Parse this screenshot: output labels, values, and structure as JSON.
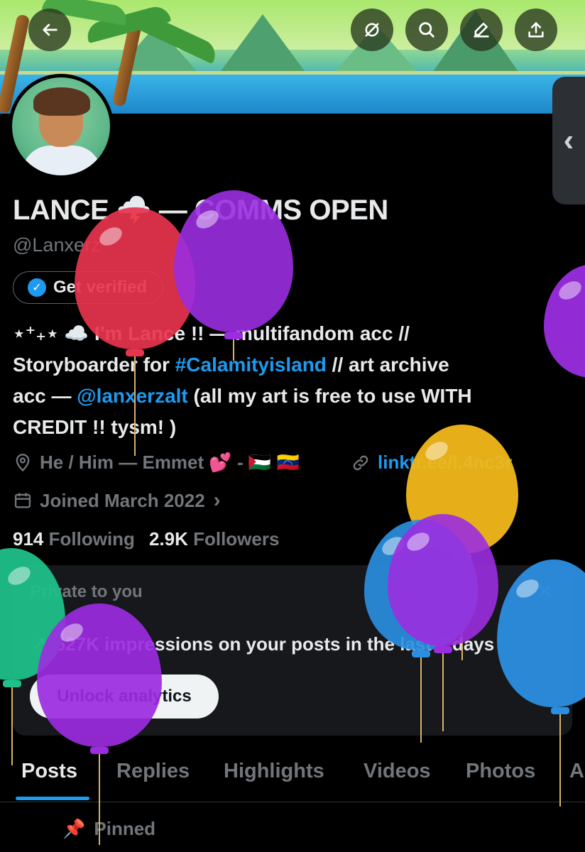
{
  "header": {
    "back_icon": "arrow-left-icon",
    "actions": [
      "grok-icon",
      "search-icon",
      "edit-icon",
      "share-icon"
    ]
  },
  "profile": {
    "display_name": "LANCE 🌩️ — COMMS OPEN",
    "handle": "@Lanxerz",
    "verify_label": "Get verified",
    "bio": {
      "line1": "⋆⁺₊⋆ ☁️ I'm Lance !! — multifandom acc //",
      "line2_prefix": "Storyboarder for ",
      "line2_link": "#Calamityisland",
      "line2_suffix": " // art archive",
      "line3_prefix": "acc — ",
      "line3_link": "@lanxerzalt",
      "line3_suffix": " (all my art is free to use WITH",
      "line4": "CREDIT !! tysm! )"
    },
    "location": "He / Him — Emmet 💕 - 🇵🇸 🇻🇪",
    "website": "linktr.ee/l.4nc3r",
    "joined": "Joined March 2022",
    "following_count": "914",
    "following_label": "Following",
    "followers_count": "2.9K",
    "followers_label": "Followers"
  },
  "private_card": {
    "title": "Private to you",
    "impressions": "627K impressions on your posts in the last 7 days",
    "unlock_label": "Unlock analytics"
  },
  "tabs": [
    "Posts",
    "Replies",
    "Highlights",
    "Videos",
    "Photos",
    "A"
  ],
  "pinned_label": "Pinned",
  "colors": {
    "accent": "#1d9bf0",
    "balloon_red": "#e8344f",
    "balloon_purple": "#9b2de0",
    "balloon_yellow": "#f2b81a",
    "balloon_blue": "#2b8ee0",
    "balloon_green": "#1fc08a"
  }
}
